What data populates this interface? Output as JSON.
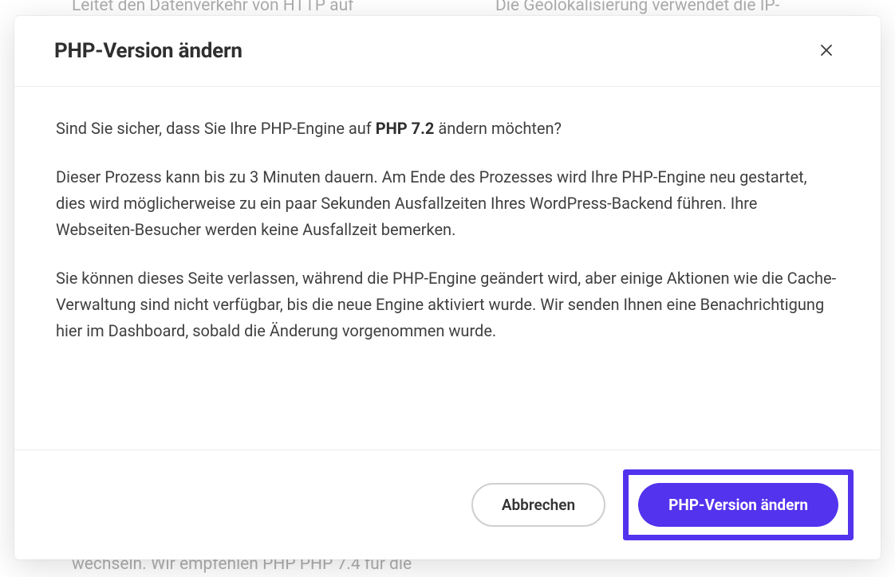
{
  "background": {
    "left_top": "Leitet den Datenverkehr von HTTP auf HTTPS",
    "right_top": "Die Geolokalisierung verwendet die IP-Adresse,",
    "bottom": "wechseln. Wir empfehlen PHP PHP 7.4 für die"
  },
  "modal": {
    "title": "PHP-Version ändern",
    "close_label": "Schließen",
    "body": {
      "p1_pre": "Sind Sie sicher, dass Sie Ihre PHP-Engine auf ",
      "p1_bold": "PHP 7.2",
      "p1_post": " ändern möchten?",
      "p2": "Dieser Prozess kann bis zu 3 Minuten dauern. Am Ende des Prozesses wird Ihre PHP-Engine neu gestartet, dies wird möglicherweise zu ein paar Sekunden Ausfallzeiten Ihres WordPress-Backend führen. Ihre Webseiten-Besucher werden keine Ausfallzeit bemerken.",
      "p3": "Sie können dieses Seite verlassen, während die PHP-Engine geändert wird, aber einige Aktionen wie die Cache-Verwaltung sind nicht verfügbar, bis die neue Engine aktiviert wurde. Wir senden Ihnen eine Benachrichtigung hier im Dashboard, sobald die Änderung vorgenommen wurde."
    },
    "footer": {
      "cancel": "Abbrechen",
      "confirm": "PHP-Version ändern"
    }
  }
}
